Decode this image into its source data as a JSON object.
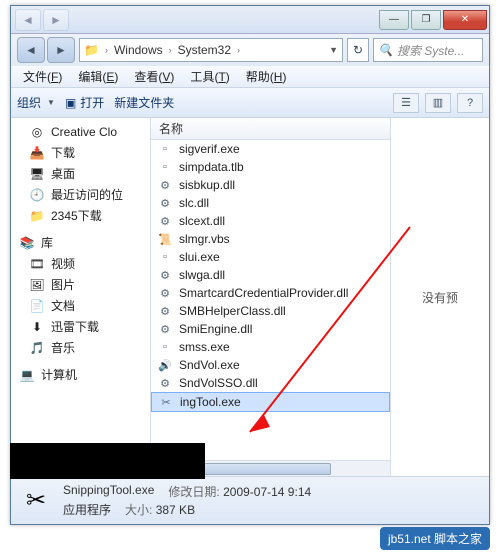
{
  "titlebar": {
    "min": "—",
    "max": "❐",
    "close": "✕"
  },
  "address": {
    "back": "◄",
    "fwd": "►",
    "folder_icon": "📁",
    "crumbs": [
      "Windows",
      "System32"
    ],
    "sep": "›",
    "dropdown": "▼",
    "refresh": "↻",
    "search_placeholder": "搜索 Syste...",
    "search_icon": "🔍"
  },
  "menu": {
    "file": "文件",
    "file_u": "F",
    "edit": "编辑",
    "edit_u": "E",
    "view": "查看",
    "view_u": "V",
    "tools": "工具",
    "tools_u": "T",
    "help": "帮助",
    "help_u": "H"
  },
  "toolbar": {
    "organize": "组织",
    "dd": "▼",
    "open_icon": "▣",
    "open": "打开",
    "newfolder": "新建文件夹",
    "view_icon": "☰",
    "preview_icon": "▥",
    "help_icon": "?"
  },
  "nav": {
    "cc_icon": "◎",
    "cc": "Creative Clo",
    "dl_icon": "📥",
    "dl": "下载",
    "desk_icon": "🖥",
    "desk": "桌面",
    "recent_icon": "🕘",
    "recent": "最近访问的位",
    "dl2_icon": "📁",
    "dl2": "2345下载",
    "lib_icon": "📚",
    "lib": "库",
    "vid_icon": "🎞",
    "vid": "视频",
    "pic_icon": "🖼",
    "pic": "图片",
    "doc_icon": "📄",
    "doc": "文档",
    "xl_icon": "⬇",
    "xl": "迅雷下载",
    "mus_icon": "🎵",
    "mus": "音乐",
    "comp_icon": "💻",
    "comp": "计算机"
  },
  "list": {
    "col_name": "名称",
    "items": [
      {
        "icon": "▫",
        "name": "sigverif.exe"
      },
      {
        "icon": "▫",
        "name": "simpdata.tlb"
      },
      {
        "icon": "⚙",
        "name": "sisbkup.dll"
      },
      {
        "icon": "⚙",
        "name": "slc.dll"
      },
      {
        "icon": "⚙",
        "name": "slcext.dll"
      },
      {
        "icon": "📜",
        "name": "slmgr.vbs"
      },
      {
        "icon": "▫",
        "name": "slui.exe"
      },
      {
        "icon": "⚙",
        "name": "slwga.dll"
      },
      {
        "icon": "⚙",
        "name": "SmartcardCredentialProvider.dll"
      },
      {
        "icon": "⚙",
        "name": "SMBHelperClass.dll"
      },
      {
        "icon": "⚙",
        "name": "SmiEngine.dll"
      },
      {
        "icon": "▫",
        "name": "smss.exe"
      },
      {
        "icon": "🔊",
        "name": "SndVol.exe"
      },
      {
        "icon": "⚙",
        "name": "SndVolSSO.dll"
      },
      {
        "icon": "✂",
        "name": "ingTool.exe"
      }
    ],
    "selected_index": 14
  },
  "preview": {
    "text": "没有预"
  },
  "status": {
    "icon": "✂",
    "name": "SnippingTool.exe",
    "date_k": "修改日期:",
    "date_v": "2009-07-14 9:14",
    "type": "应用程序",
    "size_k": "大小:",
    "size_v": "387 KB"
  },
  "watermark": "jb51.net\n脚本之家"
}
